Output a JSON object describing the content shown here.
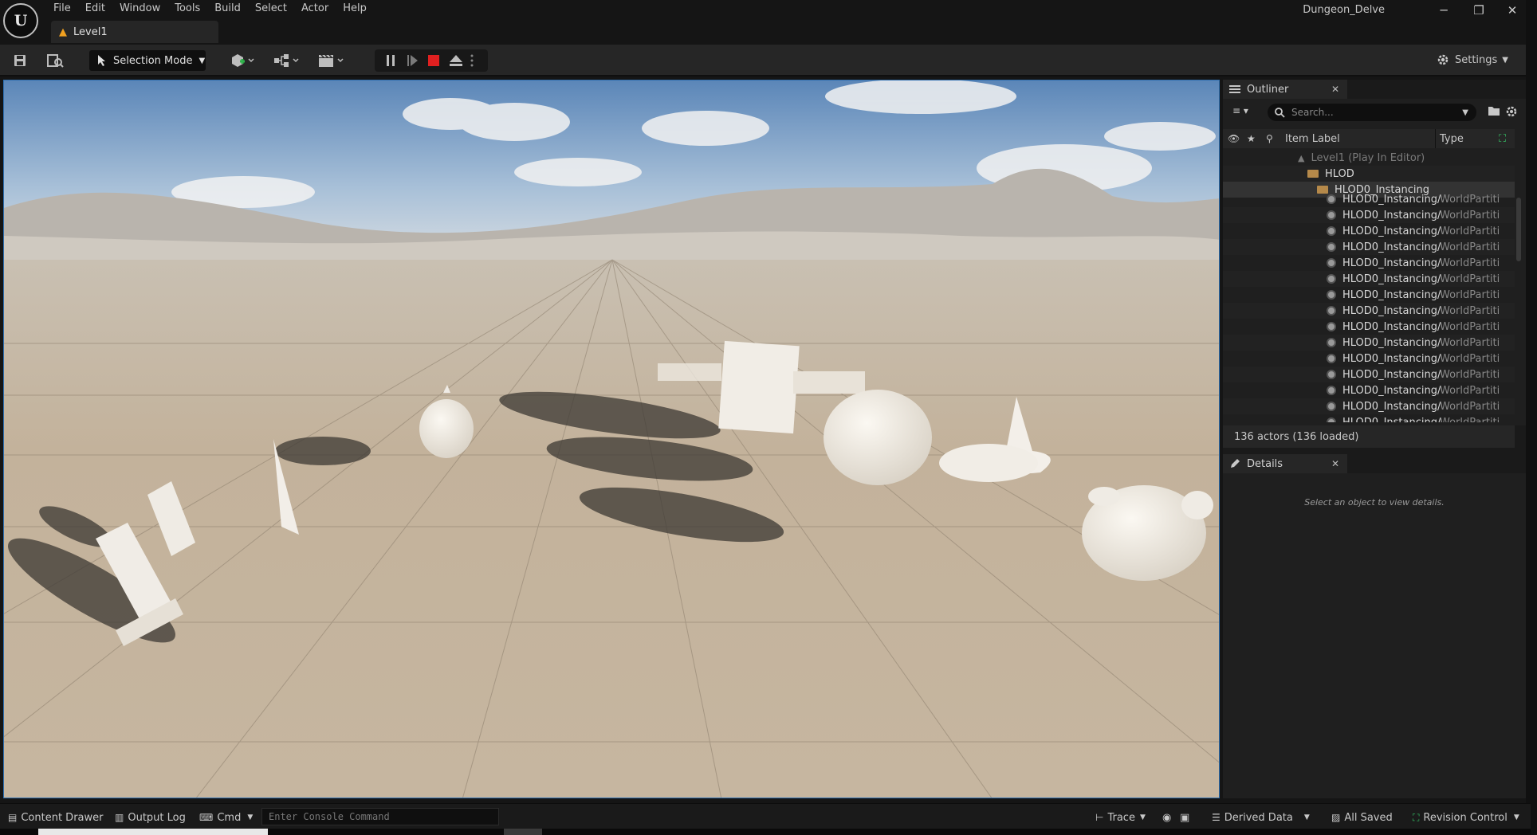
{
  "window": {
    "project_name": "Dungeon_Delve",
    "logo_text": "U",
    "controls": {
      "minimize": "─",
      "restore": "❐",
      "close": "✕"
    }
  },
  "menu": [
    "File",
    "Edit",
    "Window",
    "Tools",
    "Build",
    "Select",
    "Actor",
    "Help"
  ],
  "level_tab": {
    "label": "Level1",
    "warn_icon": "▲"
  },
  "toolbar": {
    "selection_mode": "Selection Mode",
    "settings": "Settings",
    "icons": [
      "save-icon",
      "browse-icon",
      "add-actor-icon",
      "blueprint-icon",
      "cinematics-icon"
    ]
  },
  "play_controls": {
    "state": "playing-paused",
    "stop_color": "#e02020"
  },
  "outliner": {
    "tab_label": "Outliner",
    "search_placeholder": "Search...",
    "col_label": "Item Label",
    "col_type": "Type",
    "root": "Level1 (Play In Editor)",
    "folder1": "HLOD",
    "folder2": "HLOD0_Instancing",
    "rows": [
      {
        "label": "HLOD0_Instancing/",
        "type": "WorldPartiti"
      },
      {
        "label": "HLOD0_Instancing/",
        "type": "WorldPartiti"
      },
      {
        "label": "HLOD0_Instancing/",
        "type": "WorldPartiti"
      },
      {
        "label": "HLOD0_Instancing/",
        "type": "WorldPartiti"
      },
      {
        "label": "HLOD0_Instancing/",
        "type": "WorldPartiti"
      },
      {
        "label": "HLOD0_Instancing/",
        "type": "WorldPartiti"
      },
      {
        "label": "HLOD0_Instancing/",
        "type": "WorldPartiti"
      },
      {
        "label": "HLOD0_Instancing/",
        "type": "WorldPartiti"
      },
      {
        "label": "HLOD0_Instancing/",
        "type": "WorldPartiti"
      },
      {
        "label": "HLOD0_Instancing/",
        "type": "WorldPartiti"
      },
      {
        "label": "HLOD0_Instancing/",
        "type": "WorldPartiti"
      },
      {
        "label": "HLOD0_Instancing/",
        "type": "WorldPartiti"
      },
      {
        "label": "HLOD0_Instancing/",
        "type": "WorldPartiti"
      },
      {
        "label": "HLOD0_Instancing/",
        "type": "WorldPartiti"
      },
      {
        "label": "HLOD0_Instancing/",
        "type": "WorldPartiti"
      },
      {
        "label": "HLOD0_Instancing/",
        "type": "WorldPartiti"
      }
    ],
    "actor_count": "136 actors (136 loaded)"
  },
  "details": {
    "tab_label": "Details",
    "empty_text": "Select an object to view details."
  },
  "statusbar": {
    "content_drawer": "Content Drawer",
    "output_log": "Output Log",
    "cmd": "Cmd",
    "console_placeholder": "Enter Console Command",
    "trace": "Trace",
    "derived_data": "Derived Data",
    "all_saved": "All Saved",
    "revision_control": "Revision Control"
  }
}
